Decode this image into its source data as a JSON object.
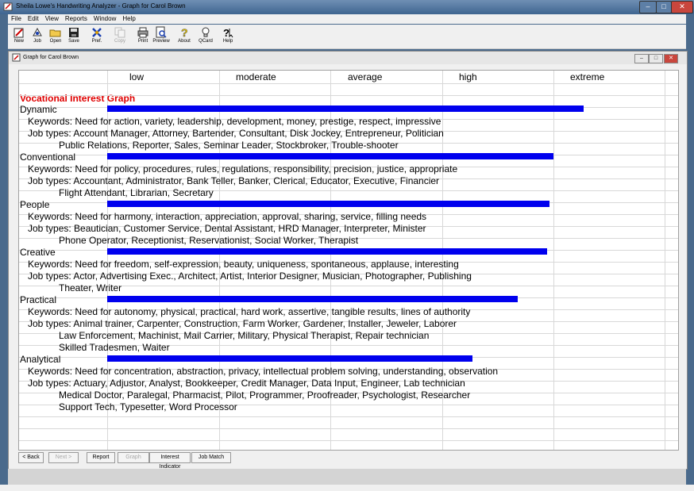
{
  "app": {
    "title": "Sheila Lowe's Handwriting Analyzer - Graph for Carol Brown",
    "window_controls": [
      "–",
      "□",
      "✕"
    ]
  },
  "menu": [
    "File",
    "Edit",
    "View",
    "Reports",
    "Window",
    "Help"
  ],
  "toolbar": [
    {
      "label": "New",
      "icon": "new-icon",
      "enabled": true
    },
    {
      "label": "Job",
      "icon": "job-icon",
      "enabled": true
    },
    {
      "label": "Open",
      "icon": "open-folder-icon",
      "enabled": true
    },
    {
      "label": "Save",
      "icon": "save-disk-icon",
      "enabled": true
    },
    {
      "label": "Pref.",
      "icon": "preferences-icon",
      "enabled": true
    },
    {
      "label": "Copy",
      "icon": "copy-icon",
      "enabled": false
    },
    {
      "label": "Print",
      "icon": "print-icon",
      "enabled": true
    },
    {
      "label": "Preview",
      "icon": "preview-icon",
      "enabled": true
    },
    {
      "label": "About",
      "icon": "about-icon",
      "enabled": true
    },
    {
      "label": "QCard",
      "icon": "qcard-icon",
      "enabled": true
    },
    {
      "label": "Help",
      "icon": "help-icon",
      "enabled": true
    }
  ],
  "document": {
    "title": "Graph for Carol Brown",
    "window_controls": [
      "–",
      "□",
      "✕"
    ]
  },
  "graph": {
    "levels": [
      "low",
      "moderate",
      "average",
      "high",
      "extreme"
    ],
    "heading": "Vocational Interest Graph",
    "bar_color": "#0000ee",
    "heading_color": "#e00000",
    "categories": [
      {
        "name": "Dynamic",
        "score": 0.853,
        "lines": [
          {
            "text": "Keywords: Need for action, variety, leadership, development, money, prestige, respect, impressive",
            "indent": 1
          },
          {
            "text": "Job types: Account Manager, Attorney, Bartender, Consultant, Disk Jockey, Entrepreneur, Politician",
            "indent": 1
          },
          {
            "text": "Public Relations, Reporter, Sales, Seminar Leader, Stockbroker, Trouble-shooter",
            "indent": 2
          }
        ]
      },
      {
        "name": "Conventional",
        "score": 0.799,
        "lines": [
          {
            "text": "Keywords: Need for policy, procedures, rules, regulations, responsibility, precision, justice, appropriate",
            "indent": 1
          },
          {
            "text": "Job types: Accountant, Administrator, Bank Teller, Banker, Clerical, Educator, Executive, Financier",
            "indent": 1
          },
          {
            "text": "Flight Attendant, Librarian, Secretary",
            "indent": 2
          }
        ]
      },
      {
        "name": "People",
        "score": 0.793,
        "lines": [
          {
            "text": "Keywords: Need for harmony, interaction, appreciation, approval, sharing, service, filling needs",
            "indent": 1
          },
          {
            "text": "Job types: Beautician, Customer Service, Dental Assistant, HRD Manager, Interpreter, Minister",
            "indent": 1
          },
          {
            "text": "Phone Operator, Receptionist, Reservationist, Social Worker, Therapist",
            "indent": 2
          }
        ]
      },
      {
        "name": "Creative",
        "score": 0.788,
        "lines": [
          {
            "text": "Keywords: Need for freedom, self-expression, beauty, uniqueness, spontaneous, applause, interesting",
            "indent": 1
          },
          {
            "text": "Job types: Actor, Advertising Exec., Architect, Artist, Interior Designer, Musician, Photographer, Publishing",
            "indent": 1
          },
          {
            "text": "Theater, Writer",
            "indent": 2
          }
        ]
      },
      {
        "name": "Practical",
        "score": 0.736,
        "lines": [
          {
            "text": "Keywords: Need for autonomy, physical, practical, hard work, assertive, tangible results, lines of authority",
            "indent": 1
          },
          {
            "text": "Job types: Animal trainer, Carpenter, Construction, Farm Worker, Gardener, Installer, Jeweler, Laborer",
            "indent": 1
          },
          {
            "text": "Law Enforcement, Machinist, Mail Carrier, Military, Physical Therapist, Repair technician",
            "indent": 2
          },
          {
            "text": "Skilled Tradesmen, Waiter",
            "indent": 2
          }
        ]
      },
      {
        "name": "Analytical",
        "score": 0.654,
        "lines": [
          {
            "text": "Keywords: Need for concentration, abstraction, privacy, intellectual problem solving, understanding, observation",
            "indent": 1
          },
          {
            "text": "Job types: Actuary, Adjustor, Analyst, Bookkeeper, Credit Manager, Data Input, Engineer, Lab technician",
            "indent": 1
          },
          {
            "text": "Medical Doctor, Paralegal, Pharmacist, Pilot, Programmer, Proofreader, Psychologist, Researcher",
            "indent": 2
          },
          {
            "text": "Support Tech, Typesetter, Word Processor",
            "indent": 2
          }
        ]
      }
    ]
  },
  "nav_buttons": [
    {
      "label": "< Back",
      "enabled": true
    },
    {
      "label": "Next >",
      "enabled": false
    },
    {
      "label": "Report",
      "enabled": true
    },
    {
      "label": "Graph",
      "enabled": false
    },
    {
      "label": "Interest Indicator",
      "enabled": true
    },
    {
      "label": "Job Match",
      "enabled": true
    }
  ]
}
